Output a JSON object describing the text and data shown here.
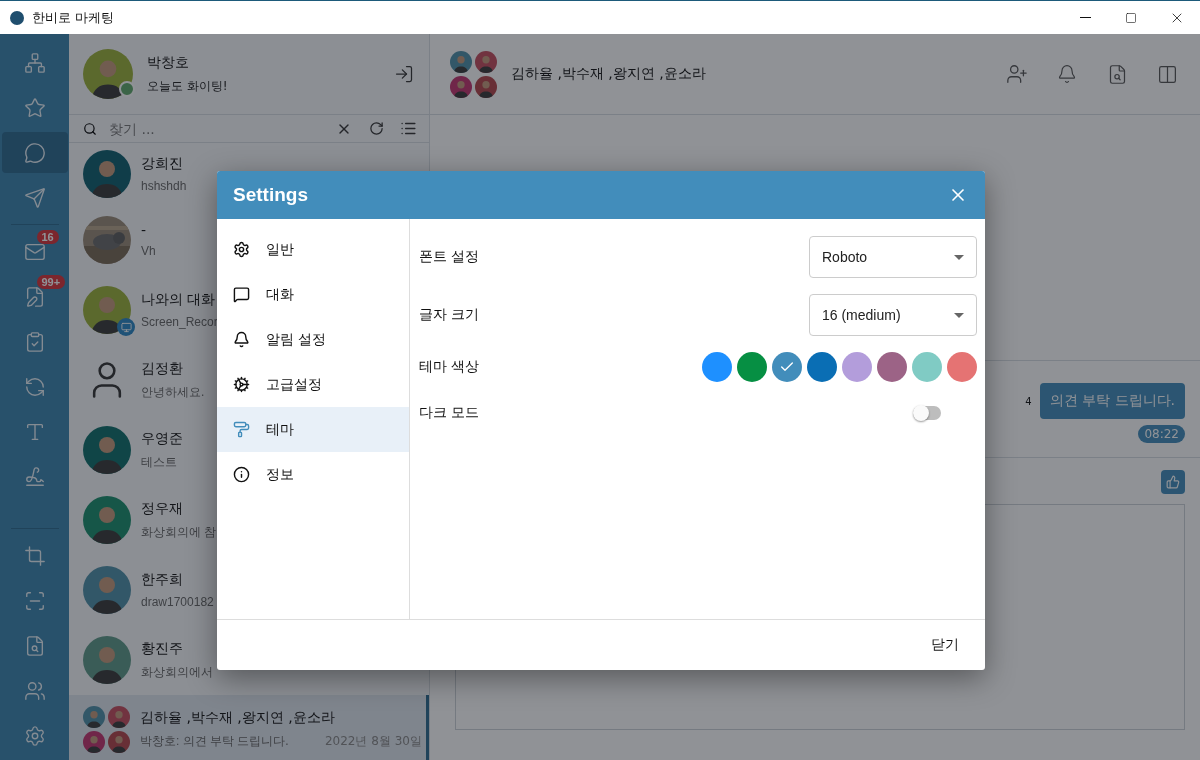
{
  "window": {
    "title": "한비로 마케팅"
  },
  "rail": {
    "top": [
      {
        "kind": "org",
        "selected": false
      },
      {
        "kind": "favorites",
        "selected": false
      },
      {
        "kind": "chat",
        "selected": true
      },
      {
        "kind": "send",
        "selected": false
      },
      {
        "kind": "mail",
        "selected": false,
        "badge": "16"
      },
      {
        "kind": "notes",
        "selected": false,
        "badge": "99+"
      },
      {
        "kind": "forms",
        "selected": false
      },
      {
        "kind": "tasks",
        "selected": false
      },
      {
        "kind": "text",
        "selected": false
      },
      {
        "kind": "sign",
        "selected": false
      }
    ],
    "bottom": [
      {
        "kind": "crop",
        "selected": false
      },
      {
        "kind": "record",
        "selected": false
      },
      {
        "kind": "doc-search",
        "selected": false
      },
      {
        "kind": "contacts",
        "selected": false
      },
      {
        "kind": "settings",
        "selected": false
      }
    ]
  },
  "profile": {
    "name": "박창호",
    "status": "오늘도 화이팅!",
    "avatar": {
      "kind": "person"
    },
    "online": true
  },
  "search": {
    "placeholder": "찾기 ..."
  },
  "contacts": [
    {
      "name": "강희진",
      "preview": "hshshdh",
      "avatar": {
        "kind": "person"
      },
      "selected": false
    },
    {
      "name": "-",
      "preview": "Vh",
      "selected": false
    },
    {
      "name": "나와의 대화",
      "preview": "Screen_Recor",
      "avatar": {
        "kind": "person"
      },
      "self": true,
      "selected": false
    },
    {
      "name": "김정환",
      "preview": "안녕하세요.",
      "avatar": {
        "kind": "outline"
      },
      "selected": false
    },
    {
      "name": "우영준",
      "preview": "테스트",
      "avatar": {
        "kind": "person"
      },
      "selected": false
    },
    {
      "name": "정우재",
      "preview": "화상회의에 참",
      "avatar": {
        "kind": "person"
      },
      "selected": false
    },
    {
      "name": "한주희",
      "preview": "draw1700182",
      "avatar": {
        "kind": "person"
      },
      "selected": false
    },
    {
      "name": "황진주",
      "preview": "화상회의에서",
      "avatar": {
        "kind": "person"
      },
      "selected": false
    },
    {
      "name": "김하율 ,박수재 ,왕지연 ,윤소라",
      "preview": "박창호: 의견 부탁 드립니다.",
      "date": "2022년 8월 30일",
      "avatar": {
        "kind": "group"
      },
      "selected": true
    }
  ],
  "chat": {
    "title": "김하율 ,박수재 ,왕지연 ,윤소라",
    "messages": [
      {
        "text": "의견 부탁 드립니다.",
        "unread": "4",
        "time": "08:22"
      }
    ]
  },
  "settings": {
    "title": "Settings",
    "nav": [
      {
        "kind": "general",
        "label": "일반",
        "selected": false
      },
      {
        "kind": "chat",
        "label": "대화",
        "selected": false
      },
      {
        "kind": "alerts",
        "label": "알림 설정",
        "selected": false
      },
      {
        "kind": "advanced",
        "label": "고급설정",
        "selected": false
      },
      {
        "kind": "theme",
        "label": "테마",
        "selected": true
      },
      {
        "kind": "info",
        "label": "정보",
        "selected": false
      }
    ],
    "font": {
      "label": "폰트 설정",
      "value": "Roboto"
    },
    "size": {
      "label": "글자 크기",
      "value": "16 (medium)"
    },
    "theme_color": {
      "label": "테마 색상",
      "swatches": [
        {
          "color": "#1e90ff",
          "selected": false
        },
        {
          "color": "#068f43",
          "selected": false
        },
        {
          "color": "#428dbb",
          "selected": true
        },
        {
          "color": "#0a6eb4",
          "selected": false
        },
        {
          "color": "#b39ddb",
          "selected": false
        },
        {
          "color": "#9c6386",
          "selected": false
        },
        {
          "color": "#80cbc4",
          "selected": false
        },
        {
          "color": "#e57373",
          "selected": false
        }
      ]
    },
    "dark_mode": {
      "label": "다크 모드",
      "on": false
    },
    "close_button": "닫기"
  }
}
